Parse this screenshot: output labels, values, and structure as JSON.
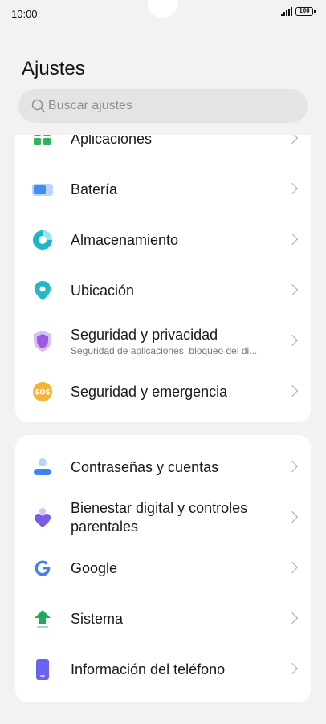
{
  "status_bar": {
    "time": "10:00",
    "battery": "100"
  },
  "header": {
    "title": "Ajustes"
  },
  "search": {
    "placeholder": "Buscar ajustes",
    "icon": "search-icon"
  },
  "group1": {
    "items": [
      {
        "label": "Aplicaciones",
        "icon": "apps-icon"
      },
      {
        "label": "Batería",
        "icon": "battery-icon"
      },
      {
        "label": "Almacenamiento",
        "icon": "storage-icon"
      },
      {
        "label": "Ubicación",
        "icon": "location-icon"
      },
      {
        "label": "Seguridad y privacidad",
        "subtitle": "Seguridad de aplicaciones, bloqueo del di...",
        "icon": "shield-icon"
      },
      {
        "label": "Seguridad y emergencia",
        "icon": "sos-icon"
      }
    ]
  },
  "group2": {
    "items": [
      {
        "label": "Contraseñas y cuentas",
        "icon": "account-icon"
      },
      {
        "label": "Bienestar digital y controles parentales",
        "icon": "wellbeing-icon"
      },
      {
        "label": "Google",
        "icon": "google-icon"
      },
      {
        "label": "Sistema",
        "icon": "system-update-icon"
      },
      {
        "label": "Información del teléfono",
        "icon": "phone-info-icon"
      }
    ]
  },
  "colors": {
    "background": "#f2f2f2",
    "card": "#ffffff",
    "apps_green": "#2fb35d",
    "battery_blue": "#3f8ef0",
    "storage_cyan": "#1cb5c9",
    "location_teal": "#23b8c9",
    "shield_purple": "#9a5be0",
    "sos_orange": "#f2b437",
    "account_blue": "#3b86f2",
    "wellbeing_purple": "#7a5be8",
    "system_green": "#22a85a",
    "phone_indigo": "#6a63f0"
  }
}
